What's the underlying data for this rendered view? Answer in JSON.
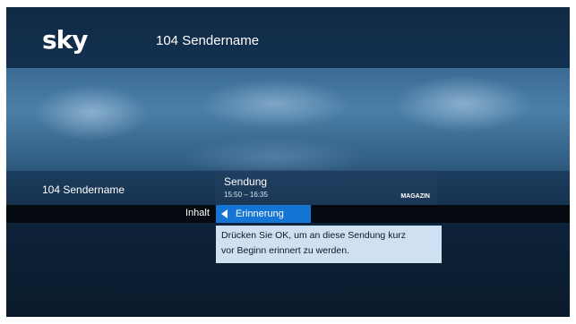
{
  "logo": "sky",
  "header": {
    "channel_title": "104 Sendername"
  },
  "info": {
    "channel": "104 Sendername",
    "program_title": "Sendung",
    "program_time": "15:50 – 16:35",
    "genre": "MAGAZIN"
  },
  "menu": {
    "label": "Inhalt",
    "selected_option": "Erinnerung"
  },
  "tooltip": {
    "text_line1": "Drücken Sie OK, um an diese Sendung kurz",
    "text_line2": "vor Beginn erinnert zu werden."
  },
  "colors": {
    "accent": "#1475d4",
    "tooltip_bg": "#cfe0f2",
    "panel": "#1b3d5e"
  },
  "icons": {
    "selector_arrow": "left-arrow-icon"
  }
}
